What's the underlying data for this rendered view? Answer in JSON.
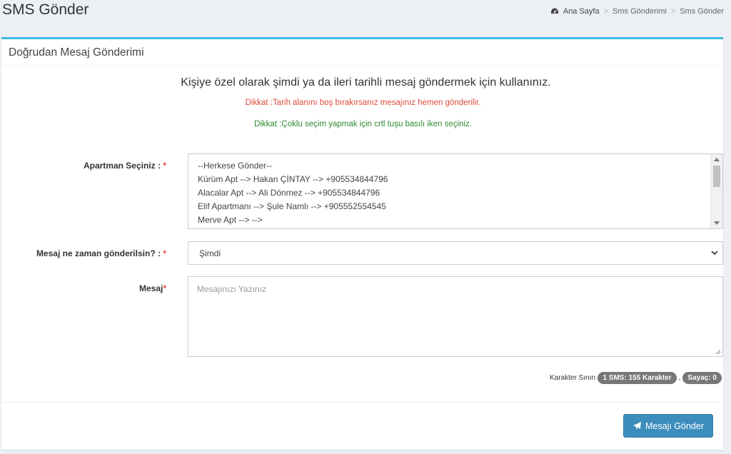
{
  "header": {
    "title": "SMS Gönder",
    "breadcrumb": [
      "Ana Sayfa",
      "Sms Gönderimi",
      "Sms Gönder"
    ],
    "breadcrumb_icon": "dashboard-icon"
  },
  "box": {
    "title": "Doğrudan Mesaj Gönderimi",
    "intro": "Kişiye özel olarak şimdi ya da ileri tarihli mesaj göndermek için kullanınız.",
    "warning_date": "Dikkat :Tarih alanını boş bırakırsanız mesajınız hemen gönderilir.",
    "warning_multi": "Dikkat :Çoklu seçim yapmak için crtl tuşu basılı iken seçiniz."
  },
  "form": {
    "apartment_label": "Apartman Seçiniz :",
    "apartment_options": [
      "--Herkese Gönder--",
      "Kürüm Apt --> Hakan ÇİNTAY --> +905534844796",
      "Alacalar Apt --> Ali Dönmez --> +905534844796",
      "Elif Apartmanı --> Şule Namlı --> +905552554545",
      "Merve Apt --> -->"
    ],
    "when_label": "Mesaj ne zaman gönderilsin? :",
    "when_value": "Şimdi",
    "message_label": "Mesaj",
    "message_placeholder": "Mesajınızı Yazınız",
    "required_mark": "*",
    "char_limit_label": "Karakter Sınırı",
    "sms_badge": "1 SMS: 155 Karakter",
    "comma": ",",
    "counter_badge": "Sayaç: 0",
    "send_label": "Mesajı Gönder"
  },
  "colors": {
    "accent": "#3cbbe0",
    "primary_button": "#3c8dbc",
    "danger": "#dd4b39",
    "success": "#2f8a32"
  }
}
